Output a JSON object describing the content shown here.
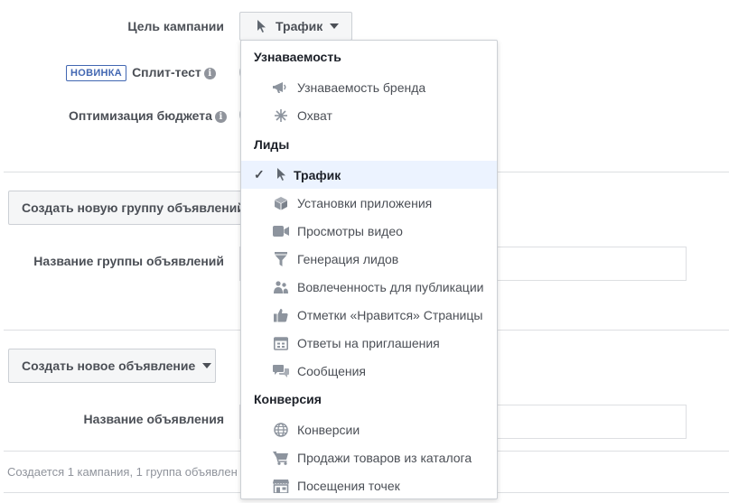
{
  "form": {
    "campaign_goal_label": "Цель кампании",
    "selected_goal": "Трафик",
    "new_badge": "НОВИНКА",
    "split_test_label": "Сплит-тест",
    "budget_opt_label": "Оптимизация бюджета",
    "info_glyph": "i"
  },
  "adset": {
    "create_button": "Создать новую группу объявлений",
    "name_label": "Название группы объявлений"
  },
  "ad": {
    "create_button": "Создать новое объявление",
    "name_label": "Название объявления"
  },
  "footer": {
    "summary": "Создается 1 кампания, 1 группа объявлен"
  },
  "menu": {
    "check_glyph": "✓",
    "sections": [
      {
        "title": "Узнаваемость",
        "items": [
          {
            "label": "Узнаваемость бренда",
            "icon": "megaphone-icon"
          },
          {
            "label": "Охват",
            "icon": "reach-snowflake-icon"
          }
        ]
      },
      {
        "title": "Лиды",
        "items": [
          {
            "label": "Трафик",
            "icon": "cursor-icon",
            "selected": true
          },
          {
            "label": "Установки приложения",
            "icon": "box-icon"
          },
          {
            "label": "Просмотры видео",
            "icon": "video-camera-icon"
          },
          {
            "label": "Генерация лидов",
            "icon": "funnel-icon"
          },
          {
            "label": "Вовлеченность для публикации",
            "icon": "people-icon"
          },
          {
            "label": "Отметки «Нравится» Страницы",
            "icon": "thumbs-up-icon"
          },
          {
            "label": "Ответы на приглашения",
            "icon": "calendar-icon"
          },
          {
            "label": "Сообщения",
            "icon": "chat-bubbles-icon"
          }
        ]
      },
      {
        "title": "Конверсия",
        "items": [
          {
            "label": "Конверсии",
            "icon": "globe-icon"
          },
          {
            "label": "Продажи товаров из каталога",
            "icon": "cart-icon"
          },
          {
            "label": "Посещения точек",
            "icon": "store-icon"
          }
        ]
      }
    ]
  }
}
